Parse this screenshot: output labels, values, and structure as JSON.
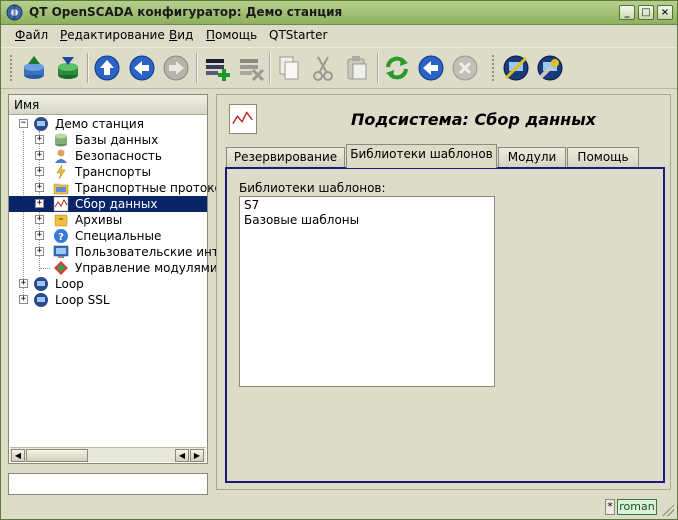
{
  "window": {
    "title": "QT OpenSCADA конфигуратор: Демо станция",
    "controls": [
      "_",
      "□",
      "×"
    ]
  },
  "menu": [
    {
      "label": "Файл",
      "mnemonic": "Ф",
      "rest": "айл"
    },
    {
      "label": "Редактирование",
      "mnemonic": "Р",
      "rest": "едактирование"
    },
    {
      "label": "Вид",
      "mnemonic": "В",
      "rest": "ид"
    },
    {
      "label": "Помощь",
      "mnemonic": "П",
      "rest": "омощь"
    },
    {
      "label": "QTStarter",
      "mnemonic": "",
      "rest": "QTStarter"
    }
  ],
  "toolbar": {
    "icons": [
      "db-load-icon",
      "db-save-icon",
      "up-icon",
      "back-icon",
      "forward-icon",
      "add-item-icon",
      "delete-item-icon",
      "copy-icon",
      "cut-icon",
      "paste-icon",
      "refresh-icon",
      "start-icon",
      "stop-icon",
      "remote-station-icon",
      "remote-station-settings-icon"
    ]
  },
  "tree": {
    "header": "Имя",
    "items": [
      {
        "label": "Демо станция",
        "level": 0,
        "expanded": true
      },
      {
        "label": "Базы данных",
        "level": 1
      },
      {
        "label": "Безопасность",
        "level": 1
      },
      {
        "label": "Транспорты",
        "level": 1
      },
      {
        "label": "Транспортные протоко",
        "level": 1
      },
      {
        "label": "Сбор данных",
        "level": 1,
        "selected": true
      },
      {
        "label": "Архивы",
        "level": 1
      },
      {
        "label": "Специальные",
        "level": 1
      },
      {
        "label": "Пользовательские инт",
        "level": 1
      },
      {
        "label": "Управление модулями",
        "level": 1
      },
      {
        "label": "Loop",
        "level": 0
      },
      {
        "label": "Loop SSL",
        "level": 0
      }
    ]
  },
  "main": {
    "title": "Подсистема: Сбор данных",
    "tabs": [
      {
        "label": "Резервирование",
        "active": false
      },
      {
        "label": "Библиотеки шаблонов",
        "active": true
      },
      {
        "label": "Модули",
        "active": false
      },
      {
        "label": "Помощь",
        "active": false
      }
    ],
    "field_label": "Библиотеки шаблонов:",
    "libraries": [
      "S7",
      "Базовые шаблоны"
    ]
  },
  "statusbar": {
    "modified": "*",
    "user": "roman"
  },
  "colors": {
    "selection": "#0a246a",
    "tab_frame": "#1a1a7a",
    "window_bg": "#dcdcc8"
  }
}
